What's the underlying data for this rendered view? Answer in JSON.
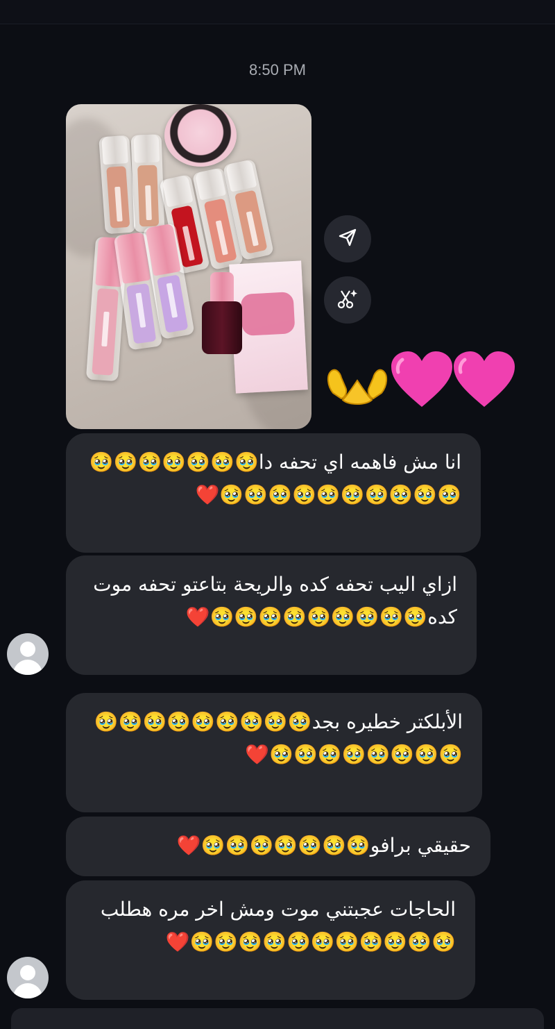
{
  "chat": {
    "timestamp": "8:50 PM",
    "shared_photo": {
      "description_icon": "product-photo",
      "reaction_emoji": "🫶💗💗"
    },
    "photo_actions": [
      {
        "icon": "share-icon"
      },
      {
        "icon": "ai-edit-icon"
      }
    ],
    "messages": [
      {
        "text": "انا مش فاهمه اي تحفه دا🥹🥹🥹🥹🥹🥹🥹🥹🥹🥹🥹🥹🥹🥹🥹🥹🥹❤️"
      },
      {
        "text": "ازاي اليب تحفه كده والريحة بتاعتو تحفه موت كده🥹🥹🥹🥹🥹🥹🥹🥹🥹❤️"
      },
      {
        "text": "الأبلكتر خطيره بجد🥹🥹🥹🥹🥹🥹🥹🥹🥹🥹🥹🥹🥹🥹🥹🥹🥹❤️"
      },
      {
        "text": "حقيقي برافو🥹🥹🥹🥹🥹🥹🥹❤️"
      },
      {
        "text": "الحاجات عجبتني موت ومش اخر مره هطلب🥹🥹🥹🥹🥹🥹🥹🥹🥹🥹🥹❤️"
      }
    ]
  },
  "colors": {
    "background": "#0c0e14",
    "bubble": "#26282e",
    "timestamp": "#a9acb3",
    "action_button": "#262830"
  }
}
